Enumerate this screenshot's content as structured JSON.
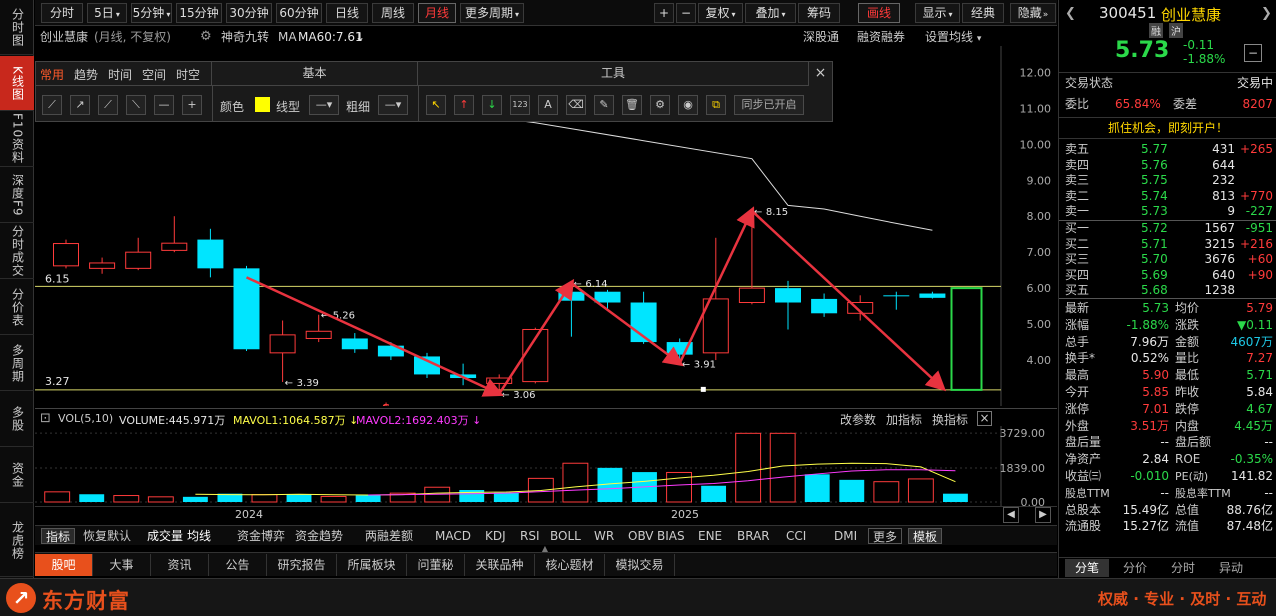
{
  "left_nav": [
    "分时图",
    "K线图",
    "F10资料",
    "深度F9",
    "分时成交",
    "分价表",
    "多周期",
    "多股",
    "资金",
    "龙虎榜"
  ],
  "left_nav_active": 1,
  "periods": [
    "分时",
    "5日",
    "5分钟",
    "15分钟",
    "30分钟",
    "60分钟",
    "日线",
    "周线",
    "月线",
    "更多周期"
  ],
  "period_active": 8,
  "top_right_buttons": [
    "+",
    "−",
    "复权",
    "叠加",
    "筹码",
    "画线",
    "显示",
    "经典",
    "隐藏"
  ],
  "top_right_active": 5,
  "info": {
    "stock_name": "创业慧康",
    "mode": "(月线, 不复权)",
    "indicator": "神奇九转",
    "ma": "MA",
    "ma60": "MA60:7.61",
    "links": [
      "深股通",
      "融资融券",
      "设置均线"
    ]
  },
  "draw_panel": {
    "tabs": [
      "常用",
      "趋势",
      "时间",
      "空间",
      "时空"
    ],
    "section_basic": "基本",
    "section_tools": "工具",
    "color_label": "颜色",
    "line_type_label": "线型",
    "width_label": "粗细",
    "sync_label": "同步已开启",
    "close": "×"
  },
  "price_axis": [
    "12.00",
    "11.00",
    "10.00",
    "9.00",
    "8.00",
    "7.00",
    "6.00",
    "5.00",
    "4.00"
  ],
  "price_lines": {
    "upper": "6.15",
    "lower": "3.27"
  },
  "annotations": [
    "5.26",
    "3.39",
    "3.06",
    "6.14",
    "3.91",
    "8.15"
  ],
  "marker": "$",
  "vol": {
    "header": "VOL(5,10)",
    "volume": "VOLUME:445.971万",
    "mavol1": "MAVOL1:1064.587万",
    "mavol2": "MAVOL2:1692.403万",
    "axis": [
      "3729.00",
      "1839.00",
      "0.00"
    ],
    "links": [
      "改参数",
      "加指标",
      "换指标"
    ],
    "close": "×"
  },
  "x_axis": [
    "2024",
    "2025"
  ],
  "indicators": [
    "指标",
    "恢复默认",
    "成交量",
    "均线",
    "资金博弈",
    "资金趋势",
    "两融差额",
    "MACD",
    "KDJ",
    "RSI",
    "BOLL",
    "WR",
    "OBV",
    "BIAS",
    "ENE",
    "BRAR",
    "CCI",
    "DMI",
    "更多",
    "模板"
  ],
  "bottom_tabs": [
    "股吧",
    "大事",
    "资讯",
    "公告",
    "研究报告",
    "所属板块",
    "问董秘",
    "关联品种",
    "核心题材",
    "模拟交易"
  ],
  "quote": {
    "code": "300451",
    "name": "创业慧康",
    "badges": [
      "融",
      "沪"
    ],
    "price": "5.73",
    "change": "-0.11",
    "change_pct": "-1.88%",
    "status_label": "交易状态",
    "status_value": "交易中",
    "ratio_label": "委比",
    "ratio_value": "65.84%",
    "diff_label": "委差",
    "diff_value": "8207",
    "promo": "抓住机会，即刻开户！",
    "asks": [
      {
        "label": "卖五",
        "price": "5.77",
        "vol": "431",
        "chg": "+265"
      },
      {
        "label": "卖四",
        "price": "5.76",
        "vol": "644",
        "chg": ""
      },
      {
        "label": "卖三",
        "price": "5.75",
        "vol": "232",
        "chg": ""
      },
      {
        "label": "卖二",
        "price": "5.74",
        "vol": "813",
        "chg": "+770"
      },
      {
        "label": "卖一",
        "price": "5.73",
        "vol": "9",
        "chg": "-227"
      }
    ],
    "bids": [
      {
        "label": "买一",
        "price": "5.72",
        "vol": "1567",
        "chg": "-951"
      },
      {
        "label": "买二",
        "price": "5.71",
        "vol": "3215",
        "chg": "+216"
      },
      {
        "label": "买三",
        "price": "5.70",
        "vol": "3676",
        "chg": "+60"
      },
      {
        "label": "买四",
        "price": "5.69",
        "vol": "640",
        "chg": "+90"
      },
      {
        "label": "买五",
        "price": "5.68",
        "vol": "1238",
        "chg": ""
      }
    ],
    "stats": [
      [
        "最新",
        "5.73",
        "均价",
        "5.79"
      ],
      [
        "涨幅",
        "-1.88%",
        "涨跌",
        "▼0.11"
      ],
      [
        "总手",
        "7.96万",
        "金额",
        "4607万"
      ],
      [
        "换手*",
        "0.52%",
        "量比",
        "7.27"
      ],
      [
        "最高",
        "5.90",
        "最低",
        "5.71"
      ],
      [
        "今开",
        "5.85",
        "昨收",
        "5.84"
      ],
      [
        "涨停",
        "7.01",
        "跌停",
        "4.67"
      ],
      [
        "外盘",
        "3.51万",
        "内盘",
        "4.45万"
      ],
      [
        "盘后量",
        "--",
        "盘后额",
        "--"
      ],
      [
        "净资产",
        "2.84",
        "ROE",
        "-0.35%"
      ],
      [
        "收益㈢",
        "-0.010",
        "PE(动)",
        "141.82"
      ],
      [
        "股息TTM",
        "--",
        "股息率TTM",
        "--"
      ],
      [
        "总股本",
        "15.49亿",
        "总值",
        "88.76亿"
      ],
      [
        "流通股",
        "15.27亿",
        "流值",
        "87.48亿"
      ]
    ],
    "bottom_tabs": [
      "分笔",
      "分价",
      "分时",
      "异动"
    ]
  },
  "footer": {
    "brand": "东方财富",
    "slogan": "权威 · 专业 · 及时 · 互动"
  },
  "colors": {
    "up": "#ff3b3b",
    "down": "#00e5ff",
    "accent": "#e8501c",
    "ma": "#dddddd",
    "arrow": "#e8333f"
  },
  "chart_data": {
    "type": "candlestick",
    "period": "monthly",
    "ylim": [
      3.0,
      12.4
    ],
    "candles": [
      {
        "o": 6.62,
        "c": 7.24,
        "h": 7.35,
        "l": 6.55
      },
      {
        "o": 6.55,
        "c": 6.7,
        "h": 6.85,
        "l": 6.4
      },
      {
        "o": 6.55,
        "c": 7.0,
        "h": 7.4,
        "l": 6.5
      },
      {
        "o": 7.05,
        "c": 7.25,
        "h": 8.0,
        "l": 7.0
      },
      {
        "o": 7.35,
        "c": 6.55,
        "h": 7.65,
        "l": 6.3
      },
      {
        "o": 6.55,
        "c": 4.3,
        "h": 6.62,
        "l": 4.25
      },
      {
        "o": 4.2,
        "c": 4.7,
        "h": 5.1,
        "l": 3.39
      },
      {
        "o": 4.6,
        "c": 4.8,
        "h": 5.26,
        "l": 4.5
      },
      {
        "o": 4.6,
        "c": 4.3,
        "h": 4.75,
        "l": 4.2
      },
      {
        "o": 4.4,
        "c": 4.1,
        "h": 4.5,
        "l": 4.0
      },
      {
        "o": 4.1,
        "c": 3.6,
        "h": 4.2,
        "l": 3.5
      },
      {
        "o": 3.6,
        "c": 3.5,
        "h": 3.9,
        "l": 3.3
      },
      {
        "o": 3.35,
        "c": 3.5,
        "h": 3.6,
        "l": 3.06
      },
      {
        "o": 3.4,
        "c": 4.85,
        "h": 4.9,
        "l": 3.35
      },
      {
        "o": 5.9,
        "c": 5.65,
        "h": 6.14,
        "l": 4.65
      },
      {
        "o": 5.9,
        "c": 5.6,
        "h": 5.95,
        "l": 5.4
      },
      {
        "o": 5.6,
        "c": 4.5,
        "h": 5.9,
        "l": 4.45
      },
      {
        "o": 4.5,
        "c": 4.15,
        "h": 4.6,
        "l": 3.91
      },
      {
        "o": 4.2,
        "c": 5.7,
        "h": 7.4,
        "l": 4.0
      },
      {
        "o": 5.6,
        "c": 6.0,
        "h": 8.15,
        "l": 5.55
      },
      {
        "o": 6.0,
        "c": 5.6,
        "h": 6.2,
        "l": 4.85
      },
      {
        "o": 5.7,
        "c": 5.3,
        "h": 5.85,
        "l": 5.2
      },
      {
        "o": 5.3,
        "c": 5.6,
        "h": 5.8,
        "l": 5.1
      },
      {
        "o": 5.8,
        "c": 5.78,
        "h": 5.9,
        "l": 5.4
      },
      {
        "o": 5.85,
        "c": 5.73,
        "h": 5.9,
        "l": 5.71
      }
    ],
    "ma60": [
      [
        7,
        11.3
      ],
      [
        10,
        11.0
      ],
      [
        13,
        10.6
      ],
      [
        16,
        10.1
      ],
      [
        19,
        9.6
      ],
      [
        20,
        8.3
      ],
      [
        21,
        8.2
      ],
      [
        22,
        8.0
      ],
      [
        23,
        7.8
      ],
      [
        24,
        7.61
      ]
    ],
    "volumes": [
      550,
      420,
      350,
      280,
      280,
      450,
      400,
      430,
      300,
      360,
      480,
      800,
      650,
      500,
      1280,
      2100,
      1850,
      1620,
      1600,
      880,
      3720,
      3720,
      1500,
      1200,
      1100,
      1250,
      450
    ],
    "mavol1": [
      null,
      null,
      null,
      null,
      420,
      400,
      390,
      420,
      390,
      380,
      400,
      480,
      520,
      540,
      620,
      820,
      980,
      1120,
      1300,
      1450,
      1650,
      1950,
      2050,
      2100,
      2080,
      1900,
      1100
    ],
    "mavol2": [
      null,
      null,
      null,
      null,
      null,
      null,
      null,
      null,
      null,
      380,
      400,
      420,
      450,
      480,
      560,
      640,
      720,
      820,
      920,
      1000,
      1150,
      1350,
      1520,
      1680,
      1750,
      1750,
      1692
    ],
    "vol_ylim": [
      0,
      3900
    ]
  }
}
